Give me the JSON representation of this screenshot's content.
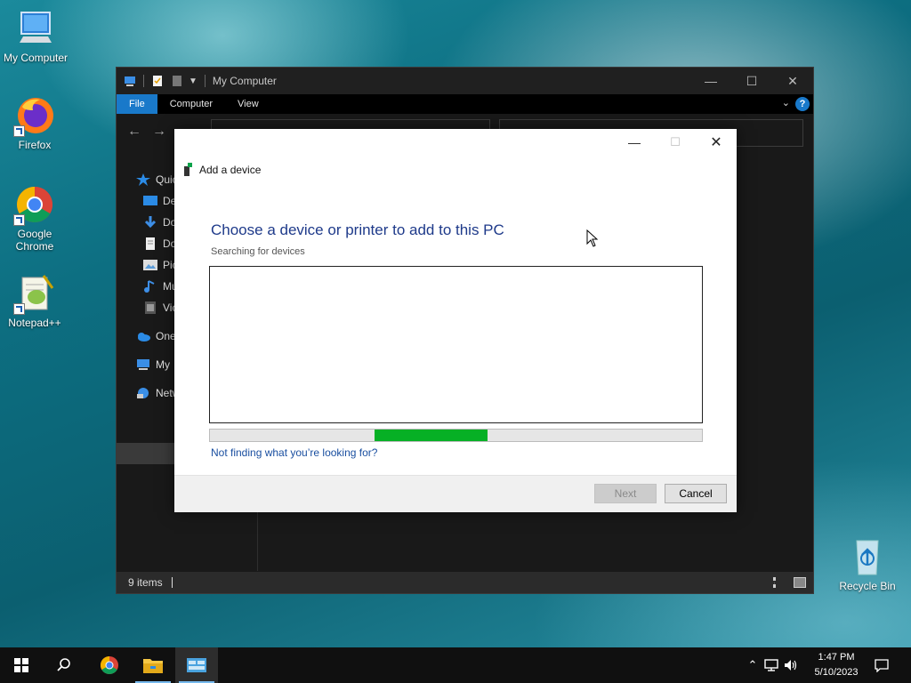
{
  "desktop": {
    "icons": [
      {
        "label": "My Computer"
      },
      {
        "label": "Firefox"
      },
      {
        "label": "Google Chrome"
      },
      {
        "label": "Notepad++"
      },
      {
        "label": "Recycle Bin"
      }
    ]
  },
  "explorer": {
    "title": "My Computer",
    "ribbon_tabs": [
      "File",
      "Computer",
      "View"
    ],
    "nav_items": [
      {
        "label": "Quic",
        "icon": "star-icon"
      },
      {
        "label": "De",
        "icon": "desktop-folder-icon"
      },
      {
        "label": "Do",
        "icon": "downloads-icon"
      },
      {
        "label": "Do",
        "icon": "documents-icon"
      },
      {
        "label": "Pic",
        "icon": "pictures-icon"
      },
      {
        "label": "Mu",
        "icon": "music-icon"
      },
      {
        "label": "Vic",
        "icon": "videos-icon"
      },
      {
        "label": "One",
        "icon": "onedrive-icon"
      },
      {
        "label": "My",
        "icon": "computer-icon"
      },
      {
        "label": "Netw",
        "icon": "network-icon"
      }
    ],
    "status_count": "9 items"
  },
  "dialog": {
    "header": "Add a device",
    "heading": "Choose a device or printer to add to this PC",
    "subheading": "Searching for devices",
    "progress": {
      "start_fraction": 0.335,
      "fill_fraction": 0.23
    },
    "link": "Not finding what you’re looking for?",
    "next_label": "Next",
    "cancel_label": "Cancel"
  },
  "taskbar": {
    "time": "1:47 PM",
    "date": "5/10/2023"
  },
  "colors": {
    "accent": "#1979ca",
    "progress": "#06b025",
    "dialog_heading": "#1e3a8a",
    "link": "#1a4fa0"
  }
}
